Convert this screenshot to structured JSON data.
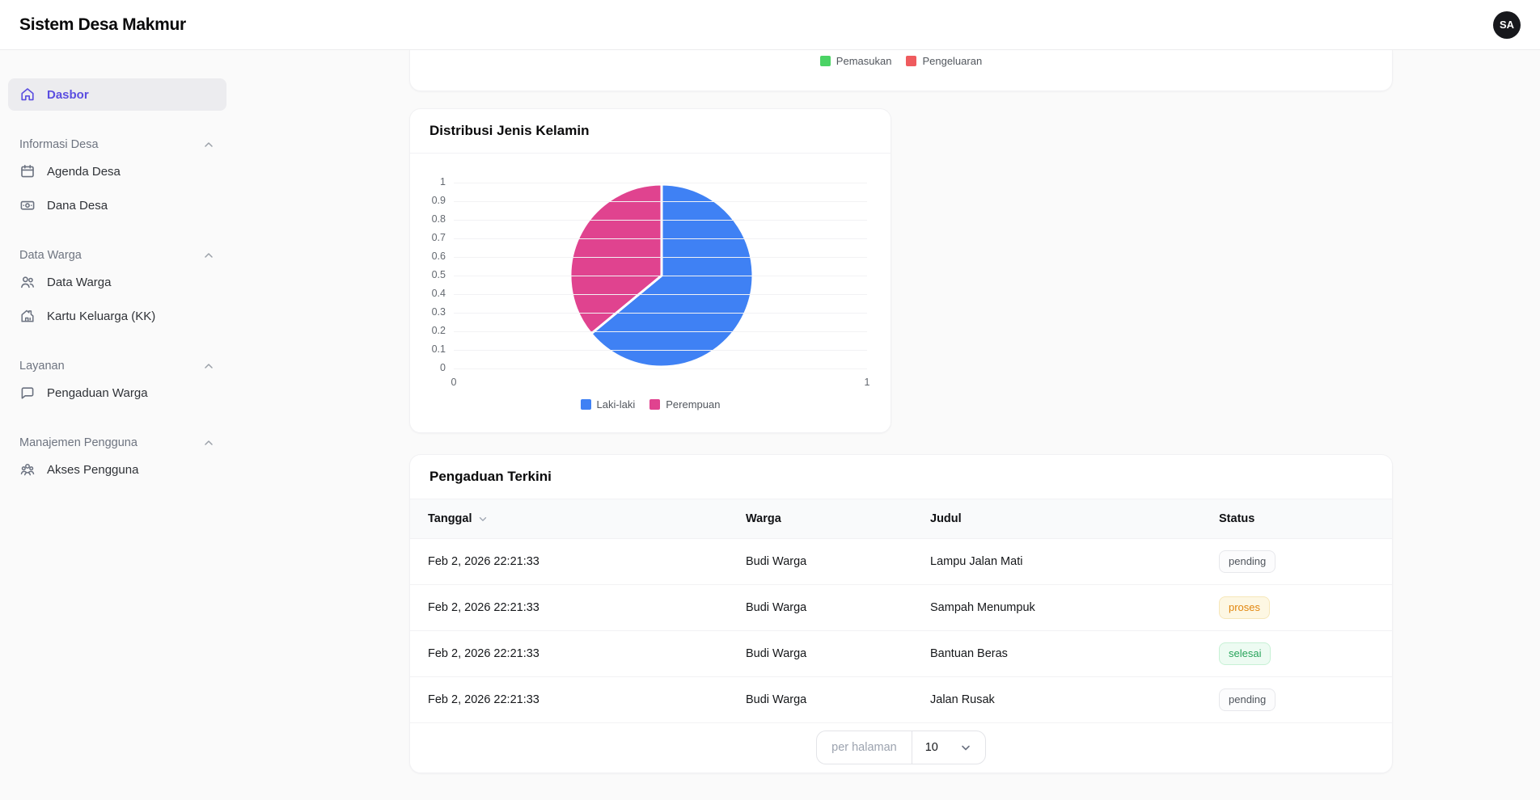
{
  "app": {
    "title": "Sistem Desa Makmur",
    "avatar_initials": "SA"
  },
  "sidebar": {
    "dashboard": {
      "label": "Dasbor",
      "icon": "home-icon",
      "active": true
    },
    "sections": [
      {
        "label": "Informasi Desa",
        "items": [
          {
            "label": "Agenda Desa",
            "icon": "calendar-icon"
          },
          {
            "label": "Dana Desa",
            "icon": "banknote-icon"
          }
        ]
      },
      {
        "label": "Data Warga",
        "items": [
          {
            "label": "Data Warga",
            "icon": "users-icon"
          },
          {
            "label": "Kartu Keluarga (KK)",
            "icon": "house-icon"
          }
        ]
      },
      {
        "label": "Layanan",
        "items": [
          {
            "label": "Pengaduan Warga",
            "icon": "chat-bubble-icon"
          }
        ]
      },
      {
        "label": "Manajemen Pengguna",
        "items": [
          {
            "label": "Akses Pengguna",
            "icon": "user-group-icon"
          }
        ]
      }
    ]
  },
  "chart_data": [
    {
      "type": "bar",
      "visible_portion": "legend only (chart scrolled above viewport)",
      "series": [
        {
          "name": "Pemasukan",
          "color": "#4bd365"
        },
        {
          "name": "Pengeluaran",
          "color": "#ef5b5e"
        }
      ],
      "legend_position": "bottom-center"
    },
    {
      "type": "pie",
      "title": "Distribusi Jenis Kelamin",
      "labels": [
        "Laki-laki",
        "Perempuan"
      ],
      "values": [
        64,
        36
      ],
      "colors": [
        "#3f81f4",
        "#e0438f"
      ],
      "y_ticks": [
        "1",
        "0.9",
        "0.8",
        "0.7",
        "0.6",
        "0.5",
        "0.4",
        "0.3",
        "0.2",
        "0.1",
        "0"
      ],
      "x_ticks": [
        "0",
        "1"
      ],
      "ylim": [
        0,
        1
      ],
      "grid": true,
      "legend_position": "bottom"
    }
  ],
  "gender_card": {
    "title": "Distribusi Jenis Kelamin"
  },
  "complaints_card": {
    "title": "Pengaduan Terkini",
    "columns": {
      "tanggal": "Tanggal",
      "warga": "Warga",
      "judul": "Judul",
      "status": "Status"
    },
    "rows": [
      {
        "tanggal": "Feb 2, 2026 22:21:33",
        "warga": "Budi Warga",
        "judul": "Lampu Jalan Mati",
        "status": "pending"
      },
      {
        "tanggal": "Feb 2, 2026 22:21:33",
        "warga": "Budi Warga",
        "judul": "Sampah Menumpuk",
        "status": "proses"
      },
      {
        "tanggal": "Feb 2, 2026 22:21:33",
        "warga": "Budi Warga",
        "judul": "Bantuan Beras",
        "status": "selesai"
      },
      {
        "tanggal": "Feb 2, 2026 22:21:33",
        "warga": "Budi Warga",
        "judul": "Jalan Rusak",
        "status": "pending"
      }
    ],
    "pagination": {
      "label": "per halaman",
      "value": "10"
    }
  },
  "colors": {
    "accent_purple": "#5b4ee0",
    "pie_blue": "#3f81f4",
    "pie_pink": "#e0438f",
    "legend_green": "#4bd365",
    "legend_red": "#ef5b5e",
    "status_pending_text": "#4f545c",
    "status_proses_text": "#e1860f",
    "status_selesai_text": "#27a45a"
  }
}
